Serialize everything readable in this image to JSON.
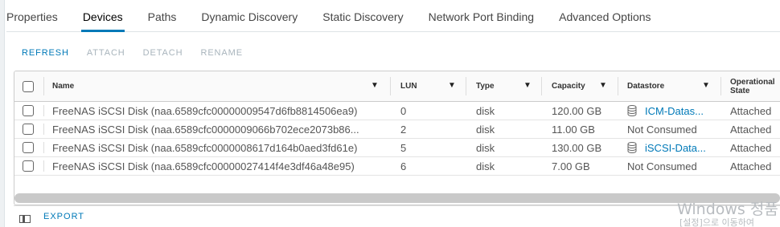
{
  "tabs": [
    "Properties",
    "Devices",
    "Paths",
    "Dynamic Discovery",
    "Static Discovery",
    "Network Port Binding",
    "Advanced Options"
  ],
  "toolbar": {
    "refresh": "REFRESH",
    "attach": "ATTACH",
    "detach": "DETACH",
    "rename": "RENAME"
  },
  "table": {
    "headers": {
      "name": "Name",
      "lun": "LUN",
      "type": "Type",
      "capacity": "Capacity",
      "datastore": "Datastore",
      "operational_state": "Operational State"
    },
    "rows": [
      {
        "name": "FreeNAS iSCSI Disk (naa.6589cfc00000009547d6fb8814506ea9)",
        "lun": "0",
        "type": "disk",
        "capacity": "120.00 GB",
        "datastore": "ICM-Datas...",
        "datastore_icon": "database-icon",
        "state": "Attached"
      },
      {
        "name": "FreeNAS iSCSI Disk (naa.6589cfc0000009066b702ece2073b86...",
        "lun": "2",
        "type": "disk",
        "capacity": "11.00 GB",
        "datastore": "Not Consumed",
        "datastore_icon": "",
        "state": "Attached"
      },
      {
        "name": "FreeNAS iSCSI Disk (naa.6589cfc0000008617d164b0aed3fd61e)",
        "lun": "5",
        "type": "disk",
        "capacity": "130.00 GB",
        "datastore": "iSCSI-Data...",
        "datastore_icon": "database-icon",
        "state": "Attached"
      },
      {
        "name": "FreeNAS iSCSI Disk (naa.6589cfc00000027414f4e3df46a48e95)",
        "lun": "6",
        "type": "disk",
        "capacity": "7.00 GB",
        "datastore": "Not Consumed",
        "datastore_icon": "",
        "state": "Attached"
      }
    ]
  },
  "footer": {
    "export": "EXPORT",
    "column_toggle_icon": "column-toggle-icon"
  },
  "watermark": {
    "line1": "Windows 정품",
    "line2": "[설정]으로 이동하여"
  },
  "colors": {
    "accent": "#0079b8",
    "disabled": "#a8b4bc"
  }
}
